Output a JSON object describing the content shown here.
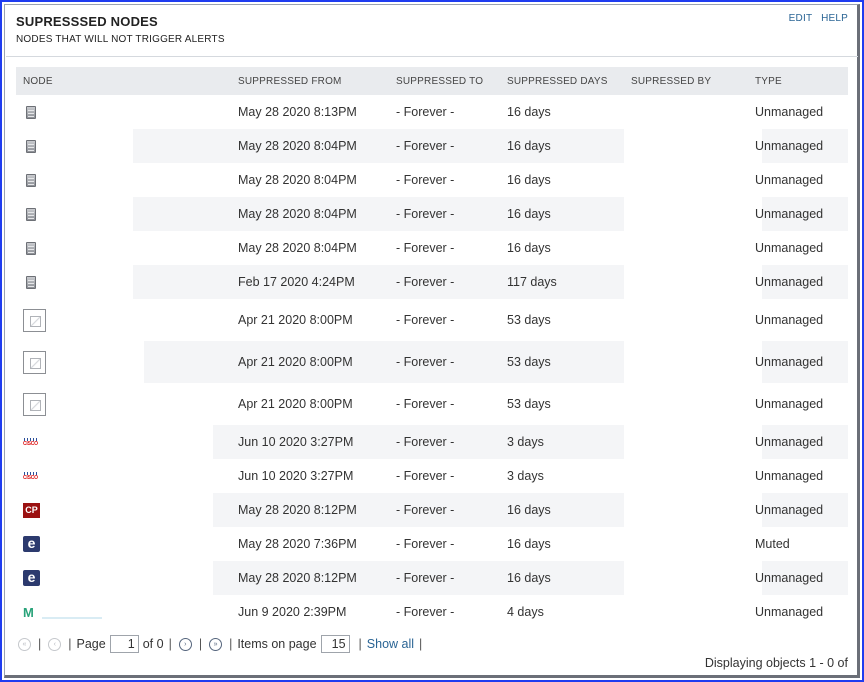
{
  "header": {
    "title": "SUPRESSSED NODES",
    "subtitle": "NODES THAT WILL NOT TRIGGER ALERTS",
    "edit_label": "EDIT",
    "help_label": "HELP"
  },
  "table": {
    "columns": [
      "NODE",
      "SUPPRESSED FROM",
      "SUPPRESSED TO",
      "SUPPRESSED DAYS",
      "SUPRESSED BY",
      "TYPE"
    ],
    "rows": [
      {
        "icon": "server-icon",
        "from": "May 28 2020 8:13PM",
        "to": "- Forever -",
        "days": "16 days",
        "by": "",
        "type": "Unmanaged"
      },
      {
        "icon": "server-icon",
        "from": "May 28 2020 8:04PM",
        "to": "- Forever -",
        "days": "16 days",
        "by": "",
        "type": "Unmanaged"
      },
      {
        "icon": "server-icon",
        "from": "May 28 2020 8:04PM",
        "to": "- Forever -",
        "days": "16 days",
        "by": "",
        "type": "Unmanaged"
      },
      {
        "icon": "server-icon",
        "from": "May 28 2020 8:04PM",
        "to": "- Forever -",
        "days": "16 days",
        "by": "",
        "type": "Unmanaged"
      },
      {
        "icon": "server-icon",
        "from": "May 28 2020 8:04PM",
        "to": "- Forever -",
        "days": "16 days",
        "by": "",
        "type": "Unmanaged"
      },
      {
        "icon": "server-icon",
        "from": "Feb 17 2020 4:24PM",
        "to": "- Forever -",
        "days": "117 days",
        "by": "",
        "type": "Unmanaged"
      },
      {
        "icon": "broken-image-icon",
        "from": "Apr 21 2020 8:00PM",
        "to": "- Forever -",
        "days": "53 days",
        "by": "",
        "type": "Unmanaged"
      },
      {
        "icon": "broken-image-icon",
        "from": "Apr 21 2020 8:00PM",
        "to": "- Forever -",
        "days": "53 days",
        "by": "",
        "type": "Unmanaged"
      },
      {
        "icon": "broken-image-icon",
        "from": "Apr 21 2020 8:00PM",
        "to": "- Forever -",
        "days": "53 days",
        "by": "",
        "type": "Unmanaged"
      },
      {
        "icon": "cisco-icon",
        "from": "Jun 10 2020 3:27PM",
        "to": "- Forever -",
        "days": "3 days",
        "by": "",
        "type": "Unmanaged"
      },
      {
        "icon": "cisco-icon",
        "from": "Jun 10 2020 3:27PM",
        "to": "- Forever -",
        "days": "3 days",
        "by": "",
        "type": "Unmanaged"
      },
      {
        "icon": "checkpoint-icon",
        "from": "May 28 2020 8:12PM",
        "to": "- Forever -",
        "days": "16 days",
        "by": "",
        "type": "Unmanaged"
      },
      {
        "icon": "e-logo-icon",
        "from": "May 28 2020 7:36PM",
        "to": "- Forever -",
        "days": "16 days",
        "by": "",
        "type": "Muted"
      },
      {
        "icon": "e-logo-icon",
        "from": "May 28 2020 8:12PM",
        "to": "- Forever -",
        "days": "16 days",
        "by": "",
        "type": "Unmanaged"
      },
      {
        "icon": "m-logo-icon",
        "from": "Jun 9 2020 2:39PM",
        "to": "- Forever -",
        "days": "4 days",
        "by": "",
        "type": "Unmanaged"
      }
    ]
  },
  "pager": {
    "page_label": "Page",
    "page_value": "1",
    "of_label": "of 0",
    "items_label": "Items on page",
    "items_value": "15",
    "show_all_label": "Show all",
    "display_text": "Displaying objects 1 - 0 of"
  },
  "icons": {
    "cisco_text": "CISCO",
    "checkpoint_text": "CP",
    "e_text": "e",
    "m_text": "M"
  }
}
